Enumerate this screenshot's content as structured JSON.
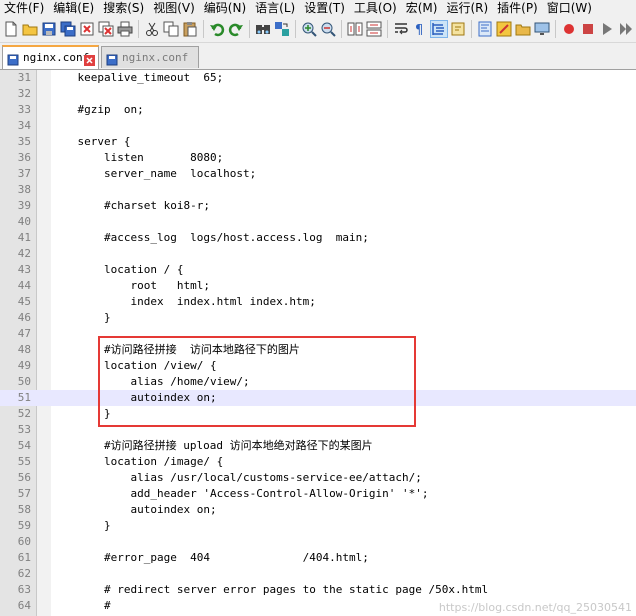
{
  "menu": [
    "文件(F)",
    "编辑(E)",
    "搜索(S)",
    "视图(V)",
    "编码(N)",
    "语言(L)",
    "设置(T)",
    "工具(O)",
    "宏(M)",
    "运行(R)",
    "插件(P)",
    "窗口(W)"
  ],
  "toolbar_icons": [
    "new-file-icon",
    "open-file-icon",
    "save-icon",
    "save-all-icon",
    "close-icon",
    "close-all-icon",
    "print-icon",
    "cut-icon",
    "copy-icon",
    "paste-icon",
    "undo-icon",
    "redo-icon",
    "find-icon",
    "replace-icon",
    "zoom-in-icon",
    "zoom-out-icon",
    "sync-scroll-icon",
    "wrap-icon",
    "show-all-chars-icon",
    "indent-guide-icon",
    "doc-map-icon",
    "function-list-icon",
    "folder-workspace-icon",
    "monitor-icon",
    "record-macro-icon"
  ],
  "tabs": [
    {
      "label": "nginx.conf",
      "active": true
    },
    {
      "label": "nginx.conf",
      "active": false
    }
  ],
  "lines": [
    {
      "num": "31",
      "text": "    keepalive_timeout  65;"
    },
    {
      "num": "32",
      "text": ""
    },
    {
      "num": "33",
      "text": "    #gzip  on;"
    },
    {
      "num": "34",
      "text": ""
    },
    {
      "num": "35",
      "text": "    server {"
    },
    {
      "num": "36",
      "text": "        listen       8080;"
    },
    {
      "num": "37",
      "text": "        server_name  localhost;"
    },
    {
      "num": "38",
      "text": ""
    },
    {
      "num": "39",
      "text": "        #charset koi8-r;"
    },
    {
      "num": "40",
      "text": ""
    },
    {
      "num": "41",
      "text": "        #access_log  logs/host.access.log  main;"
    },
    {
      "num": "42",
      "text": ""
    },
    {
      "num": "43",
      "text": "        location / {"
    },
    {
      "num": "44",
      "text": "            root   html;"
    },
    {
      "num": "45",
      "text": "            index  index.html index.htm;"
    },
    {
      "num": "46",
      "text": "        }"
    },
    {
      "num": "47",
      "text": ""
    },
    {
      "num": "48",
      "text": "        #访问路径拼接  访问本地路径下的图片"
    },
    {
      "num": "49",
      "text": "        location /view/ {"
    },
    {
      "num": "50",
      "text": "            alias /home/view/;"
    },
    {
      "num": "51",
      "text": "            autoindex on;"
    },
    {
      "num": "52",
      "text": "        }"
    },
    {
      "num": "53",
      "text": ""
    },
    {
      "num": "54",
      "text": "        #访问路径拼接 upload 访问本地绝对路径下的某图片"
    },
    {
      "num": "55",
      "text": "        location /image/ {"
    },
    {
      "num": "56",
      "text": "            alias /usr/local/customs-service-ee/attach/;"
    },
    {
      "num": "57",
      "text": "            add_header 'Access-Control-Allow-Origin' '*';"
    },
    {
      "num": "58",
      "text": "            autoindex on;"
    },
    {
      "num": "59",
      "text": "        }"
    },
    {
      "num": "60",
      "text": ""
    },
    {
      "num": "61",
      "text": "        #error_page  404              /404.html;"
    },
    {
      "num": "62",
      "text": ""
    },
    {
      "num": "63",
      "text": "        # redirect server error pages to the static page /50x.html"
    },
    {
      "num": "64",
      "text": "        #"
    }
  ],
  "current_line": "51",
  "watermark": "https://blog.csdn.net/qq_25030541"
}
